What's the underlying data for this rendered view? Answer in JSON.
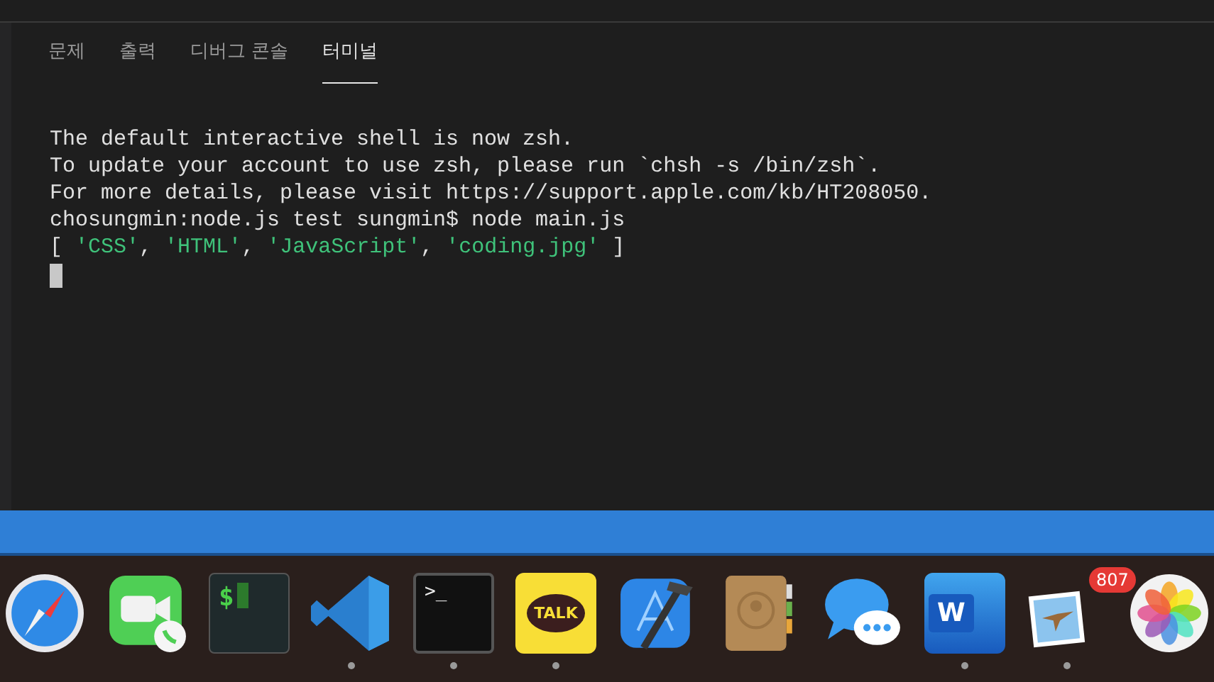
{
  "tabs": [
    {
      "label": "문제",
      "selected": false
    },
    {
      "label": "출력",
      "selected": false
    },
    {
      "label": "디버그 콘솔",
      "selected": false
    },
    {
      "label": "터미널",
      "selected": true
    }
  ],
  "terminal": {
    "lines": [
      [
        {
          "text": "The default interactive shell is now zsh.",
          "kind": "plain"
        }
      ],
      [
        {
          "text": "To update your account to use zsh, please run `chsh -s /bin/zsh`.",
          "kind": "plain"
        }
      ],
      [
        {
          "text": "For more details, please visit https://support.apple.com/kb/HT208050.",
          "kind": "plain"
        }
      ],
      [
        {
          "text": "chosungmin:node.js test sungmin$ node main.js",
          "kind": "plain"
        }
      ],
      [
        {
          "text": "[ ",
          "kind": "plain"
        },
        {
          "text": "'CSS'",
          "kind": "string"
        },
        {
          "text": ", ",
          "kind": "plain"
        },
        {
          "text": "'HTML'",
          "kind": "string"
        },
        {
          "text": ", ",
          "kind": "plain"
        },
        {
          "text": "'JavaScript'",
          "kind": "string"
        },
        {
          "text": ", ",
          "kind": "plain"
        },
        {
          "text": "'coding.jpg'",
          "kind": "string"
        },
        {
          "text": " ]",
          "kind": "plain"
        }
      ]
    ]
  },
  "dock": {
    "items": [
      {
        "kind": "compass",
        "running": false
      },
      {
        "kind": "video-call",
        "running": false
      },
      {
        "kind": "console",
        "glyph": "$",
        "running": false
      },
      {
        "kind": "code-editor",
        "running": true
      },
      {
        "kind": "terminal",
        "glyph": ">_",
        "running": true
      },
      {
        "kind": "chat-talk",
        "glyph": "TALK",
        "running": true
      },
      {
        "kind": "hammer",
        "running": false
      },
      {
        "kind": "contacts",
        "running": false
      },
      {
        "kind": "messages",
        "running": false
      },
      {
        "kind": "word",
        "glyph": "W",
        "running": true
      },
      {
        "kind": "mail",
        "badge": "807",
        "running": true
      },
      {
        "kind": "photos",
        "running": false
      }
    ]
  }
}
